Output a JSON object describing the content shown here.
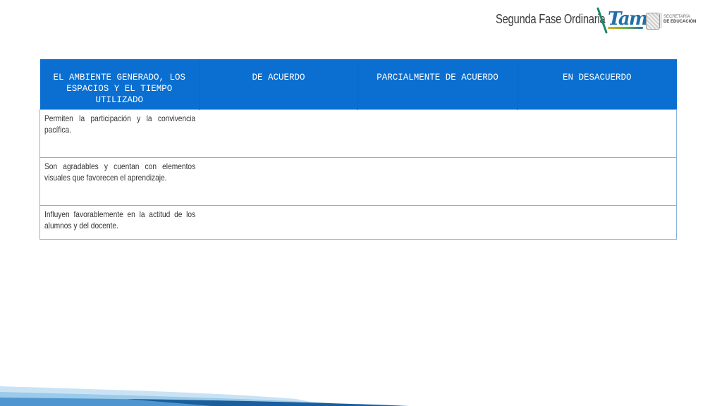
{
  "header": {
    "title": "Segunda Fase Ordinaria",
    "logo_text": "Tam",
    "logo_secretaria_line1": "SECRETARÍA",
    "logo_secretaria_line2": "DE EDUCACIÓN"
  },
  "table": {
    "headers": [
      "EL AMBIENTE GENERADO, LOS ESPACIOS Y EL TIEMPO UTILIZADO",
      "DE ACUERDO",
      "PARCIALMENTE DE ACUERDO",
      "EN DESACUERDO"
    ],
    "rows": [
      [
        "Permiten la participación y la convivencia pacífica.",
        "",
        "",
        ""
      ],
      [
        "Son agradables y cuentan con elementos visuales que favorecen el aprendizaje.",
        "",
        "",
        ""
      ],
      [
        "Influyen favorablemente en la actitud de los alumnos y del docente.",
        "",
        "",
        ""
      ]
    ]
  },
  "colors": {
    "header_blue": "#0a6fd1",
    "border_blue": "#8fb3d9",
    "deco_dark": "#1a5e9e",
    "deco_light": "#9ccbea"
  }
}
